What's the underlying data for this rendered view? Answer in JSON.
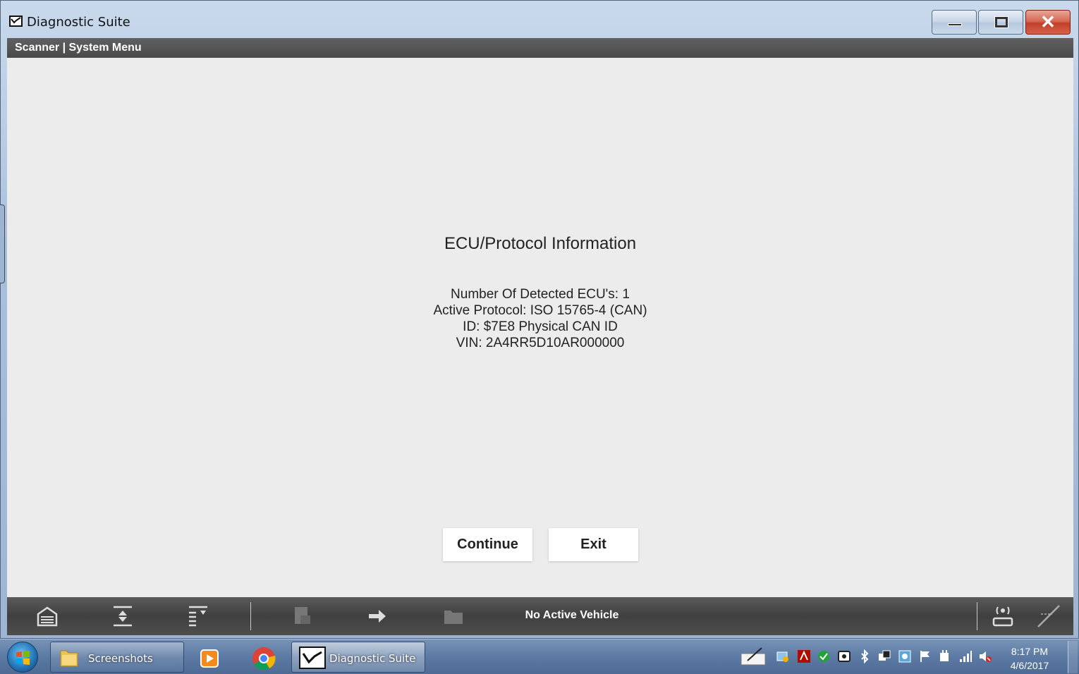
{
  "window": {
    "title": "Diagnostic Suite",
    "close_glyph": "✕"
  },
  "menubar": {
    "path": "Scanner | System Menu"
  },
  "info": {
    "heading": "ECU/Protocol Information",
    "lines": [
      "Number Of Detected ECU's: 1",
      "Active Protocol: ISO 15765-4 (CAN)",
      "ID: $7E8 Physical CAN ID",
      "VIN: 2A4RR5D10AR000000"
    ]
  },
  "buttons": {
    "continue": "Continue",
    "exit": "Exit"
  },
  "toolbar": {
    "status": "No Active Vehicle",
    "icons": [
      "home-icon",
      "expand-icon",
      "list-icon",
      "report-icon",
      "transfer-icon",
      "folder-icon",
      "connection-icon",
      "signal-icon"
    ]
  },
  "taskbar": {
    "items": [
      {
        "label": "Screenshots",
        "icon": "folder-icon"
      },
      {
        "label": "",
        "icon": "media-player-icon"
      },
      {
        "label": "",
        "icon": "chrome-icon"
      },
      {
        "label": "Diagnostic Suite",
        "icon": "diagnostic-suite-icon"
      }
    ],
    "time": "8:17 PM",
    "date": "4/6/2017"
  },
  "colors": {
    "accent_close": "#c1402a",
    "content_bg": "#ececec",
    "bar_bg": "#4a4a4a"
  }
}
